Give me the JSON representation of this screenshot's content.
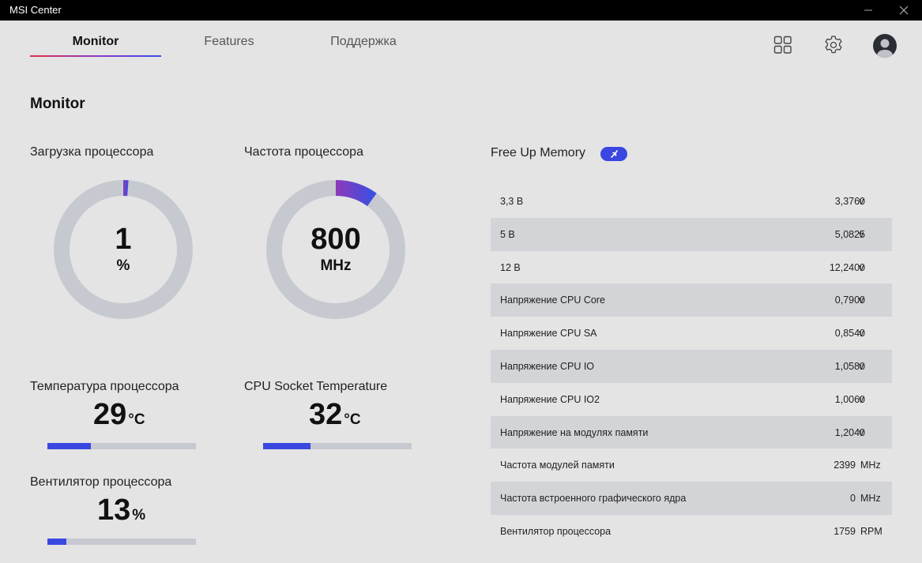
{
  "window": {
    "title": "MSI Center"
  },
  "nav": {
    "tabs": [
      {
        "label": "Monitor"
      },
      {
        "label": "Features"
      },
      {
        "label": "Поддержка"
      }
    ]
  },
  "page_title": "Monitor",
  "cpu_load": {
    "label": "Загрузка процессора",
    "value": "1",
    "unit": "%",
    "fraction": 0.01
  },
  "cpu_freq": {
    "label": "Частота процессора",
    "value": "800",
    "unit": "MHz",
    "fraction": 0.1
  },
  "cpu_temp": {
    "label": "Температура процессора",
    "value": "29",
    "unit": "°C",
    "fraction": 0.29
  },
  "socket_temp": {
    "label": "CPU Socket Temperature",
    "value": "32",
    "unit": "°C",
    "fraction": 0.32
  },
  "cpu_fan": {
    "label": "Вентилятор процессора",
    "value": "13",
    "unit": "%",
    "fraction": 0.13
  },
  "free_memory": {
    "label": "Free Up Memory"
  },
  "colors": {
    "accent": "#3b48e0",
    "track": "#c6c9d0",
    "gauge_gradient_start": "#8e3ab8",
    "gauge_gradient_end": "#3d4ee0"
  },
  "readings": [
    {
      "name": "3,3 В",
      "value": "3,3760",
      "unit": "v"
    },
    {
      "name": "5 В",
      "value": "5,0825",
      "unit": "v"
    },
    {
      "name": "12 В",
      "value": "12,2400",
      "unit": "v"
    },
    {
      "name": "Напряжение CPU Core",
      "value": "0,7900",
      "unit": "v"
    },
    {
      "name": "Напряжение CPU SA",
      "value": "0,8540",
      "unit": "v"
    },
    {
      "name": "Напряжение CPU IO",
      "value": "1,0580",
      "unit": "v"
    },
    {
      "name": "Напряжение CPU IO2",
      "value": "1,0060",
      "unit": "v"
    },
    {
      "name": "Напряжение на модулях памяти",
      "value": "1,2040",
      "unit": "v"
    },
    {
      "name": "Частота модулей памяти",
      "value": "2399",
      "unit": "MHz"
    },
    {
      "name": "Частота встроенного графического ядра",
      "value": "0",
      "unit": "MHz"
    },
    {
      "name": "Вентилятор процессора",
      "value": "1759",
      "unit": "RPM"
    }
  ]
}
